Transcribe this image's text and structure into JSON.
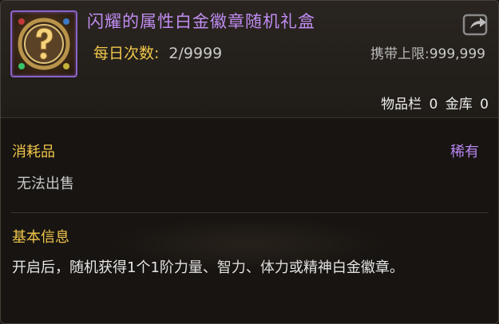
{
  "item": {
    "name": "闪耀的属性白金徽章随机礼盒",
    "icon": "mystery-box-icon",
    "name_color": "#c08cf2"
  },
  "usage": {
    "daily_label": "每日次数:",
    "daily_value": "2/9999",
    "carry_label": "携带上限:",
    "carry_value": "999,999"
  },
  "storage": {
    "bag_label": "物品栏",
    "bag_value": "0",
    "vault_label": "金库",
    "vault_value": "0"
  },
  "category": {
    "type": "消耗品",
    "rarity": "稀有",
    "sell_status": "无法出售",
    "rarity_color": "#b886f0"
  },
  "info": {
    "title": "基本信息",
    "description": "开启后，随机获得1个1阶力量、智力、体力或精神白金徽章。"
  },
  "colors": {
    "label_gold": "#f0c64a",
    "border_purple": "#8a63c9"
  }
}
